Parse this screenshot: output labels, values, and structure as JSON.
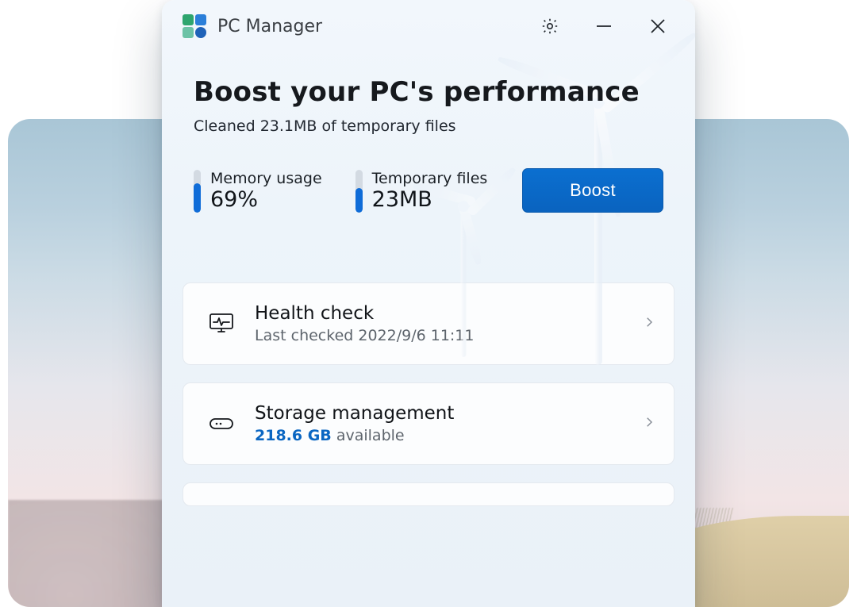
{
  "app": {
    "title": "PC Manager"
  },
  "hero": {
    "headline": "Boost your PC's performance",
    "subline": "Cleaned 23.1MB of temporary files"
  },
  "stats": {
    "memory": {
      "label": "Memory usage",
      "value": "69%",
      "fill_pct": 69
    },
    "temp": {
      "label": "Temporary files",
      "value": "23MB",
      "fill_pct": 58
    }
  },
  "boost": {
    "label": "Boost"
  },
  "cards": {
    "health": {
      "title": "Health check",
      "subtitle": "Last checked 2022/9/6 11:11"
    },
    "storage": {
      "title": "Storage management",
      "available_value": "218.6 GB",
      "available_suffix": " available"
    }
  }
}
